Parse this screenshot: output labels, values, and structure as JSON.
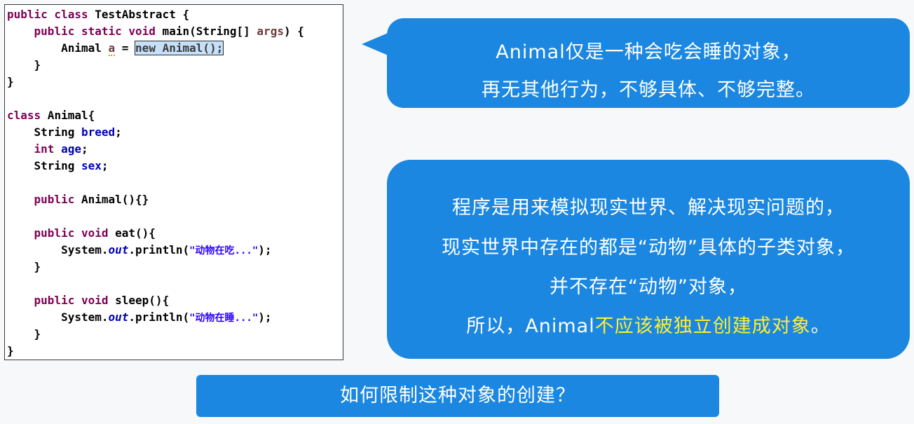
{
  "code": {
    "l1": {
      "kw": "public class",
      "rest": " TestAbstract {"
    },
    "l2": {
      "indent": "    ",
      "kw": "public static void",
      "rest": " main(String[] ",
      "arg": "args",
      "end": ") {"
    },
    "l3": {
      "indent": "        ",
      "type": "Animal ",
      "var": "a",
      "eq": " = ",
      "hl": "new Animal();"
    },
    "l4": "    }",
    "l5": "}",
    "l6": {
      "kw": "class",
      "rest": " Animal{"
    },
    "l7": {
      "indent": "    ",
      "type": "String ",
      "field": "breed",
      "end": ";"
    },
    "l8": {
      "indent": "    ",
      "kw": "int",
      "sp": " ",
      "field": "age",
      "end": ";"
    },
    "l9": {
      "indent": "    ",
      "type": "String ",
      "field": "sex",
      "end": ";"
    },
    "l10": {
      "indent": "    ",
      "kw": "public",
      "rest": " Animal(){}"
    },
    "l11": {
      "indent": "    ",
      "kw": "public void",
      "rest": " eat(){"
    },
    "l12": {
      "indent": "        ",
      "pre": "System.",
      "out": "out",
      "mid": ".println(",
      "str": "\"动物在吃...\"",
      "end": ");"
    },
    "l13": "    }",
    "l14": {
      "indent": "    ",
      "kw": "public void",
      "rest": " sleep(){"
    },
    "l15": {
      "indent": "        ",
      "pre": "System.",
      "out": "out",
      "mid": ".println(",
      "str": "\"动物在睡...\"",
      "end": ");"
    },
    "l16": "    }",
    "l17": "}"
  },
  "bubble_top": {
    "line1": "Animal仅是一种会吃会睡的对象，",
    "line2": "再无其他行为，不够具体、不够完整。"
  },
  "bubble_mid": {
    "line1": "程序是用来模拟现实世界、解决现实问题的，",
    "line2": "现实世界中存在的都是“动物”具体的子类对象，",
    "line3": "并不存在“动物”对象，",
    "line4_prefix": "所以，Animal",
    "line4_highlight": "不应该被独立创建成对象",
    "line4_suffix": "。"
  },
  "bottom_bar": "如何限制这种对象的创建？",
  "colors": {
    "bubble": "#1b87e0",
    "highlight_text": "#ffee33",
    "keyword": "#7f0055",
    "field": "#0000c0",
    "string": "#2a00ff"
  }
}
